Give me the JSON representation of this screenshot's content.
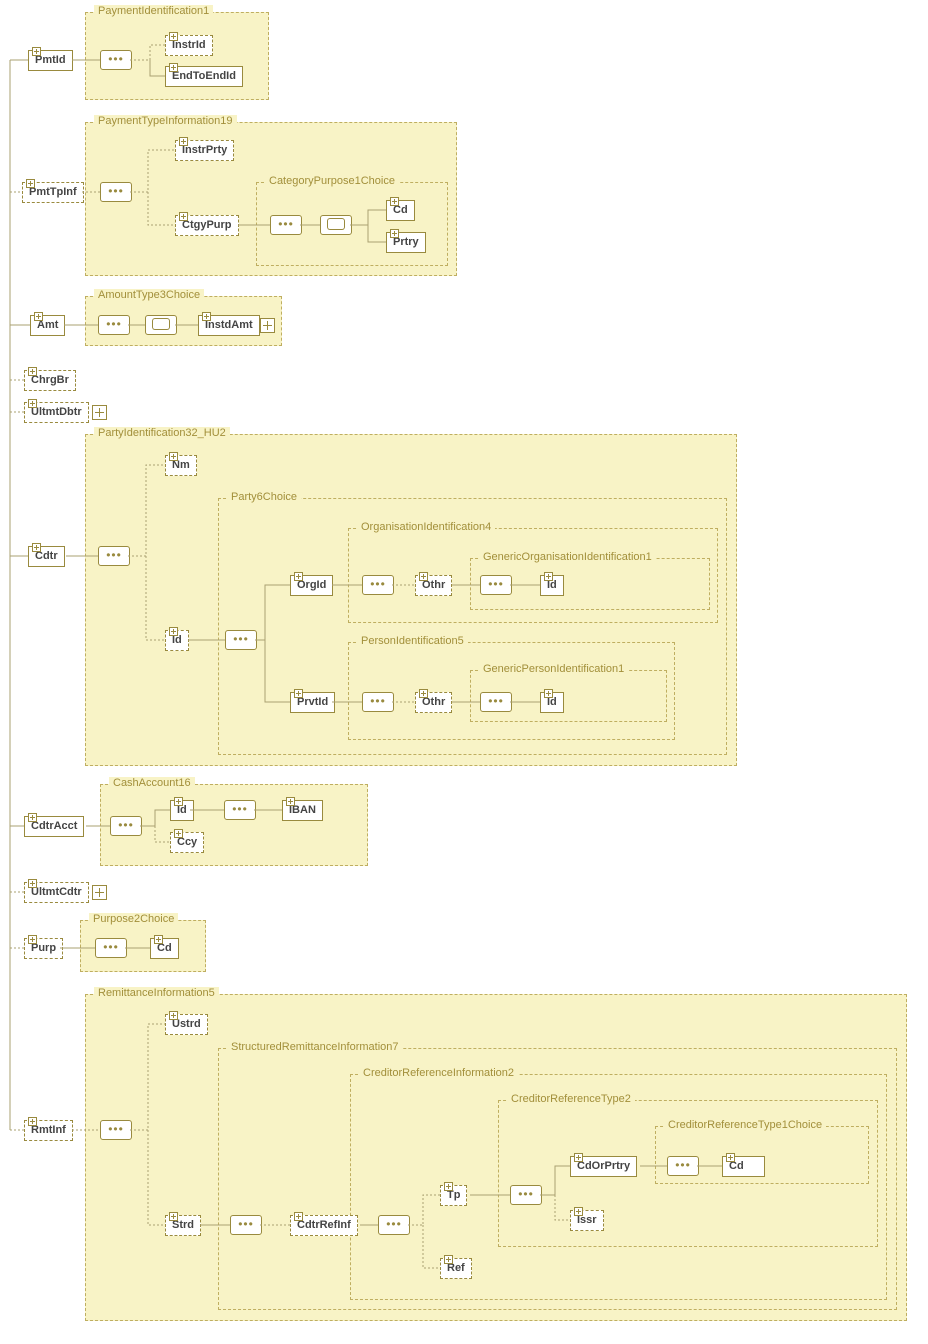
{
  "root_children": {
    "pmtId": {
      "label": "PmtId",
      "group": "PaymentIdentification1",
      "children": {
        "instrId": "InstrId",
        "endToEndId": "EndToEndId"
      }
    },
    "pmtTpInf": {
      "label": "PmtTpInf",
      "group": "PaymentTypeInformation19",
      "instrPrty": "InstrPrty",
      "ctgyPurp": {
        "label": "CtgyPurp",
        "group": "CategoryPurpose1Choice",
        "cd": "Cd",
        "prtry": "Prtry"
      }
    },
    "amt": {
      "label": "Amt",
      "group": "AmountType3Choice",
      "instdAmt": "InstdAmt"
    },
    "chrgBr": "ChrgBr",
    "ultmtDbtr": "UltmtDbtr",
    "cdtr": {
      "label": "Cdtr",
      "group": "PartyIdentification32_HU2",
      "nm": "Nm",
      "id": {
        "label": "Id",
        "group": "Party6Choice",
        "orgId": {
          "label": "OrgId",
          "group": "OrganisationIdentification4",
          "othr": {
            "label": "Othr",
            "group": "GenericOrganisationIdentification1",
            "id": "Id"
          }
        },
        "prvtId": {
          "label": "PrvtId",
          "group": "PersonIdentification5",
          "othr": {
            "label": "Othr",
            "group": "GenericPersonIdentification1",
            "id": "Id"
          }
        }
      }
    },
    "cdtrAcct": {
      "label": "CdtrAcct",
      "group": "CashAccount16",
      "id": {
        "label": "Id",
        "iban": "IBAN"
      },
      "ccy": "Ccy"
    },
    "ultmtCdtr": "UltmtCdtr",
    "purp": {
      "label": "Purp",
      "group": "Purpose2Choice",
      "cd": "Cd"
    },
    "rmtInf": {
      "label": "RmtInf",
      "group": "RemittanceInformation5",
      "ustrd": "Ustrd",
      "strd": {
        "label": "Strd",
        "group": "StructuredRemittanceInformation7",
        "cdtrRefInf": {
          "label": "CdtrRefInf",
          "group": "CreditorReferenceInformation2",
          "tp": {
            "label": "Tp",
            "group": "CreditorReferenceType2",
            "cdOrPrtry": {
              "label": "CdOrPrtry",
              "group": "CreditorReferenceType1Choice",
              "cd": "Cd"
            },
            "issr": "Issr"
          },
          "ref": "Ref"
        }
      }
    }
  }
}
